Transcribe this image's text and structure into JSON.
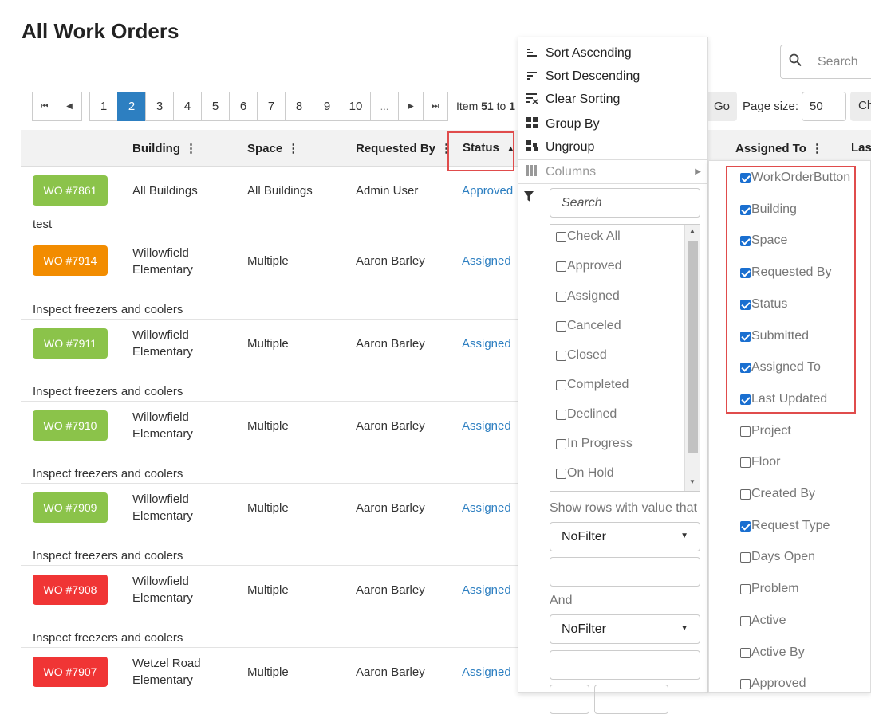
{
  "page": {
    "title": "All Work Orders"
  },
  "pager": {
    "first": "⏮",
    "prev": "◀",
    "next": "▶",
    "last": "⏭",
    "pages": [
      "1",
      "2",
      "3",
      "4",
      "5",
      "6",
      "7",
      "8",
      "9",
      "10",
      "..."
    ],
    "active": "2",
    "item_prefix": "Item ",
    "item_from": "51",
    "item_mid": " to ",
    "item_to": "1"
  },
  "toolbar": {
    "search_placeholder": "Search",
    "go_label": "Go",
    "page_size_label": "Page size:",
    "page_size_value": "50",
    "ch_label": "Ch"
  },
  "grid": {
    "headers": {
      "building": "Building",
      "space": "Space",
      "requested_by": "Requested By",
      "status": "Status",
      "assigned_to": "Assigned To",
      "last": "Las"
    },
    "rows": [
      {
        "wo": "WO #7861",
        "color": "#8bc34a",
        "building": "All Buildings",
        "space": "All Buildings",
        "requested_by": "Admin User",
        "status": "Approved",
        "desc": "test"
      },
      {
        "wo": "WO #7914",
        "color": "#f28c00",
        "building": "Willowfield Elementary",
        "space": "Multiple",
        "requested_by": "Aaron Barley",
        "status": "Assigned",
        "desc": "Inspect freezers and coolers"
      },
      {
        "wo": "WO #7911",
        "color": "#8bc34a",
        "building": "Willowfield Elementary",
        "space": "Multiple",
        "requested_by": "Aaron Barley",
        "status": "Assigned",
        "desc": "Inspect freezers and coolers"
      },
      {
        "wo": "WO #7910",
        "color": "#8bc34a",
        "building": "Willowfield Elementary",
        "space": "Multiple",
        "requested_by": "Aaron Barley",
        "status": "Assigned",
        "desc": "Inspect freezers and coolers"
      },
      {
        "wo": "WO #7909",
        "color": "#8bc34a",
        "building": "Willowfield Elementary",
        "space": "Multiple",
        "requested_by": "Aaron Barley",
        "status": "Assigned",
        "desc": "Inspect freezers and coolers"
      },
      {
        "wo": "WO #7908",
        "color": "#f03535",
        "building": "Willowfield Elementary",
        "space": "Multiple",
        "requested_by": "Aaron Barley",
        "status": "Assigned",
        "desc": "Inspect freezers and coolers"
      },
      {
        "wo": "WO #7907",
        "color": "#f03535",
        "building": "Wetzel Road Elementary",
        "space": "Multiple",
        "requested_by": "Aaron Barley",
        "status": "Assigned",
        "desc": ""
      }
    ]
  },
  "column_menu": {
    "sort_asc": "Sort Ascending",
    "sort_desc": "Sort Descending",
    "clear_sort": "Clear Sorting",
    "group_by": "Group By",
    "ungroup": "Ungroup",
    "columns": "Columns",
    "filter_search_placeholder": "Search",
    "filter_items": [
      "Check All",
      "Approved",
      "Assigned",
      "Canceled",
      "Closed",
      "Completed",
      "Declined",
      "In Progress",
      "On Hold"
    ],
    "show_rows_label": "Show rows with value that",
    "op1": "NoFilter",
    "and_label": "And",
    "op2": "NoFilter"
  },
  "columns_panel": [
    {
      "label": "WorkOrderButton",
      "checked": true
    },
    {
      "label": "Building",
      "checked": true
    },
    {
      "label": "Space",
      "checked": true
    },
    {
      "label": "Requested By",
      "checked": true
    },
    {
      "label": "Status",
      "checked": true
    },
    {
      "label": "Submitted",
      "checked": true
    },
    {
      "label": "Assigned To",
      "checked": true
    },
    {
      "label": "Last Updated",
      "checked": true
    },
    {
      "label": "Project",
      "checked": false
    },
    {
      "label": "Floor",
      "checked": false
    },
    {
      "label": "Created By",
      "checked": false
    },
    {
      "label": "Request Type",
      "checked": true
    },
    {
      "label": "Days Open",
      "checked": false
    },
    {
      "label": "Problem",
      "checked": false
    },
    {
      "label": "Active",
      "checked": false
    },
    {
      "label": "Active By",
      "checked": false
    },
    {
      "label": "Approved",
      "checked": false
    }
  ],
  "colors": {
    "accent": "#2d7fc1",
    "highlight": "#e04c4c"
  }
}
